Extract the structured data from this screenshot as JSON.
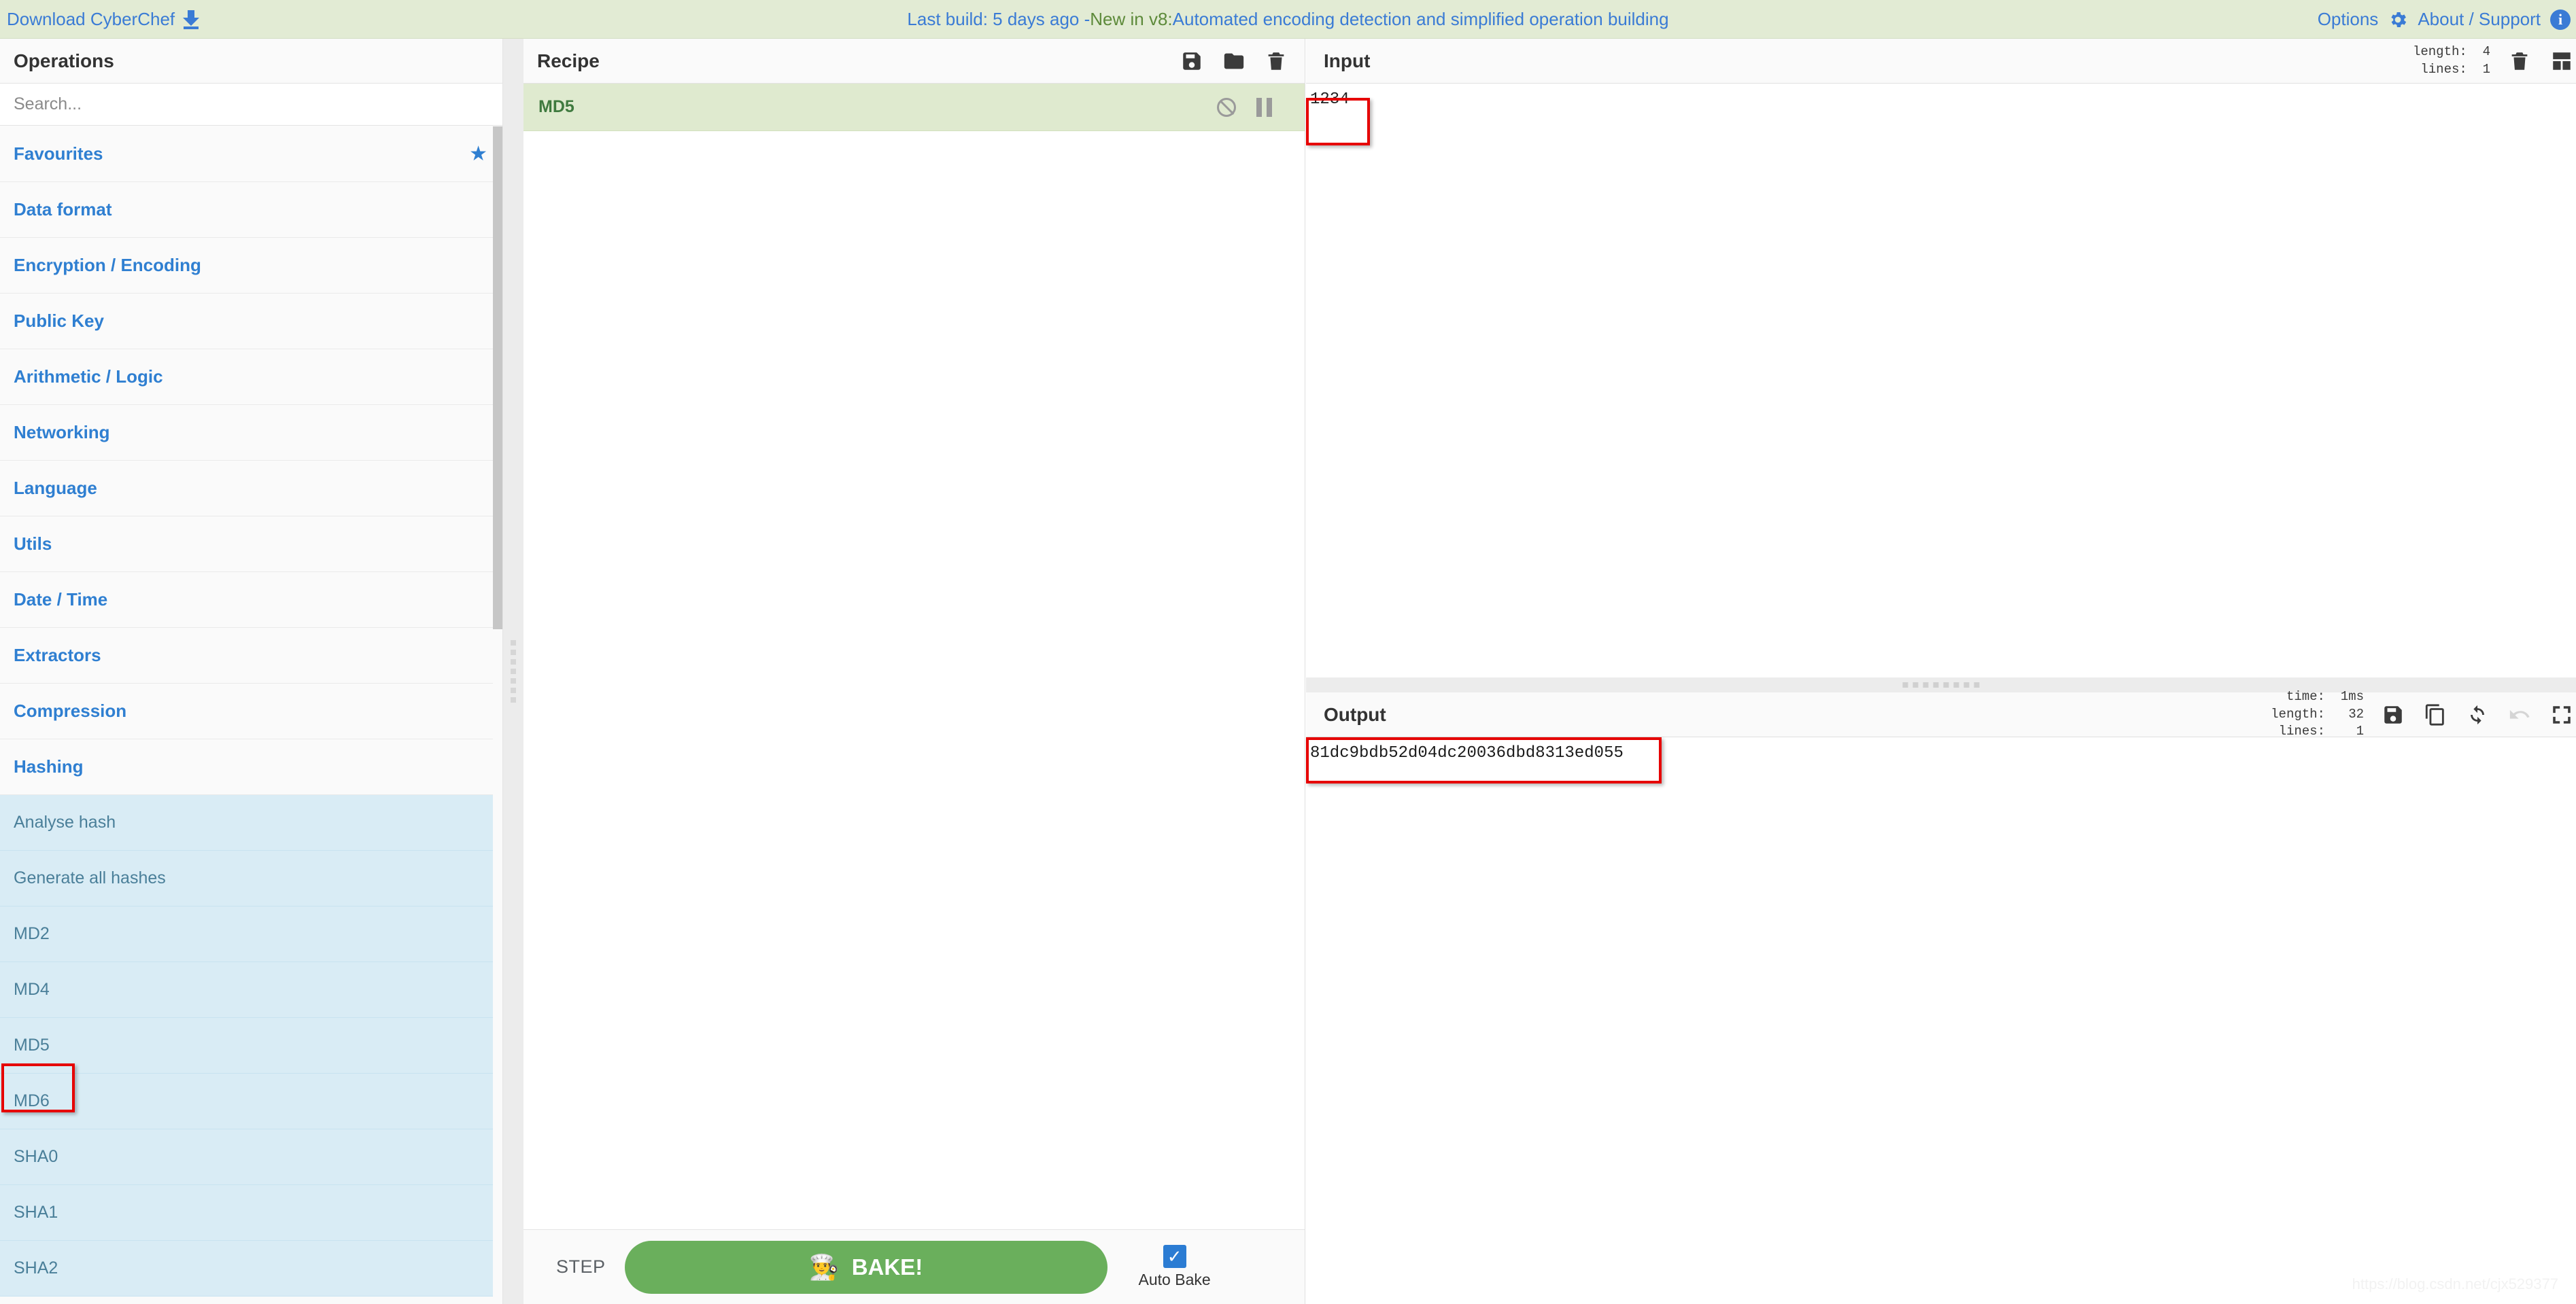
{
  "banner": {
    "download_label": "Download CyberChef",
    "download_icon": "download-arrow-icon",
    "build_text": "Last build: 5 days ago - ",
    "version_text": "New in v8:",
    "feature_text": " Automated encoding detection and simplified operation building",
    "options_label": "Options",
    "options_icon": "gear-icon",
    "about_label": "About / Support",
    "about_icon": "info-circle-icon",
    "link_color": "#3a7bd5",
    "accent_green": "#5d8a3a",
    "background": "#e2ebd4"
  },
  "operations": {
    "title": "Operations",
    "search_placeholder": "Search...",
    "search_value": "",
    "favourites": {
      "label": "Favourites",
      "icon": "star-icon"
    },
    "categories": [
      "Data format",
      "Encryption / Encoding",
      "Public Key",
      "Arithmetic / Logic",
      "Networking",
      "Language",
      "Utils",
      "Date / Time",
      "Extractors",
      "Compression",
      "Hashing"
    ],
    "hashing_ops": [
      "Analyse hash",
      "Generate all hashes",
      "MD2",
      "MD4",
      "MD5",
      "MD6",
      "SHA0",
      "SHA1",
      "SHA2"
    ],
    "highlighted_op": "MD5"
  },
  "recipe": {
    "title": "Recipe",
    "icons": [
      "save-icon",
      "folder-open-icon",
      "trash-icon"
    ],
    "operations": [
      {
        "name": "MD5",
        "disable_icon": "disable-circle-slash-icon",
        "pause_icon": "pause-icon"
      }
    ],
    "step_label": "STEP",
    "bake_label": "BAKE!",
    "bake_icon": "chef-icon",
    "bake_color": "#6aaf5c",
    "auto_bake_label": "Auto Bake",
    "auto_bake_checked": "✓"
  },
  "input": {
    "title": "Input",
    "value": "1234",
    "stats": "length:  4\nlines:  1",
    "stats_length_label": "length:",
    "stats_length_value": "4",
    "stats_lines_label": "lines:",
    "stats_lines_value": "1",
    "icons": [
      "trash-icon",
      "grid-layout-icon"
    ]
  },
  "output": {
    "title": "Output",
    "value": "81dc9bdb52d04dc20036dbd8313ed055",
    "stats_time_label": "time:",
    "stats_time_value": "1ms",
    "stats_length_label": "length:",
    "stats_length_value": "32",
    "stats_lines_label": "lines:",
    "stats_lines_value": "1",
    "icons": [
      "save-icon",
      "copy-icon",
      "refresh-icon",
      "undo-icon",
      "maximize-icon"
    ]
  },
  "watermark": "https://blog.csdn.net/cjx529377"
}
